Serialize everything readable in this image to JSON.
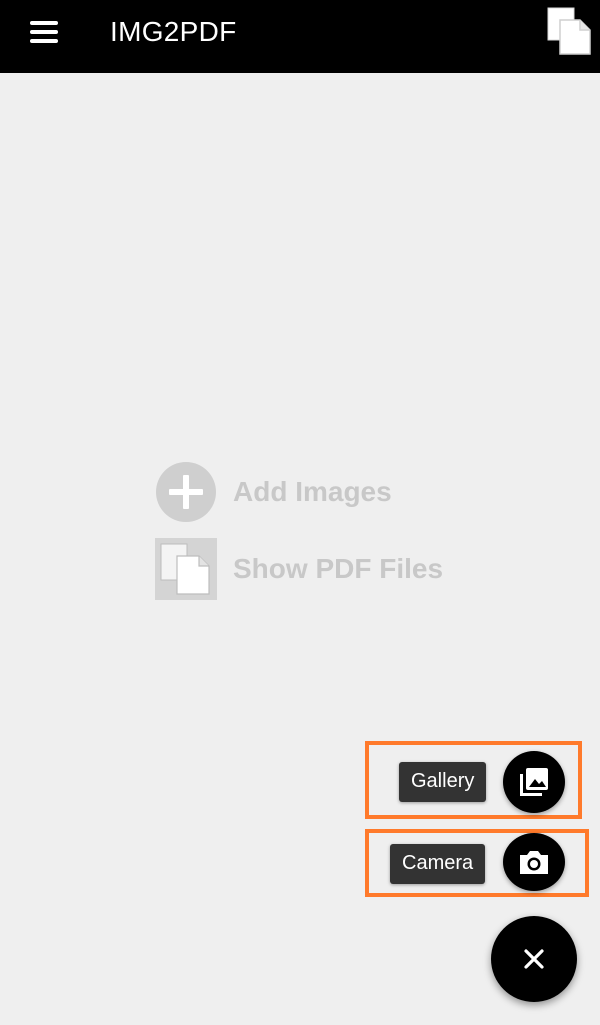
{
  "app": {
    "title": "IMG2PDF"
  },
  "toolbar": {
    "menu_icon": "hamburger-menu-icon",
    "files_icon": "copy-files-icon"
  },
  "empty_state": {
    "add_images_label": "Add Images",
    "show_pdf_label": "Show PDF Files",
    "add_icon": "add-circle-icon",
    "pdf_icon": "files-icon"
  },
  "fab_menu": {
    "gallery_label": "Gallery",
    "camera_label": "Camera",
    "gallery_icon": "photo-library-icon",
    "camera_icon": "camera-icon",
    "close_icon": "close-icon"
  },
  "colors": {
    "toolbar": "#000000",
    "background": "#efefef",
    "highlight": "#ff7a2b",
    "chip": "#333333",
    "muted_text": "#c8c8c8"
  }
}
